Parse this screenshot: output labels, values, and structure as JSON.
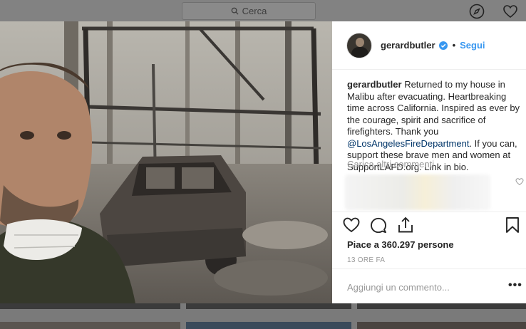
{
  "topbar": {
    "search_placeholder": "Cerca",
    "icons": [
      "compass-icon",
      "heart-icon"
    ]
  },
  "post": {
    "username": "gerardbutler",
    "verified": true,
    "follow_label": "Segui",
    "caption_user": "gerardbutler",
    "caption_part1": " Returned to my house in Malibu after evacuating. Heartbreaking time across California. Inspired as ever by the courage, spirit and sacrifice of firefighters. Thank you ",
    "caption_mention": "@LosAngelesFireDepartment",
    "caption_part2": ". If you can, support these brave men and women at SupportLAFD.org. Link in bio.",
    "load_more_label": "Carica altri commenti",
    "likes": "Piace a 360.297 persone",
    "timestamp": "13 ORE FA",
    "comment_placeholder": "Aggiungi un commento...",
    "more_label": "•••"
  },
  "colors": {
    "accent": "#3897f0",
    "mention": "#003569",
    "overlay": "#7a7a7a"
  }
}
